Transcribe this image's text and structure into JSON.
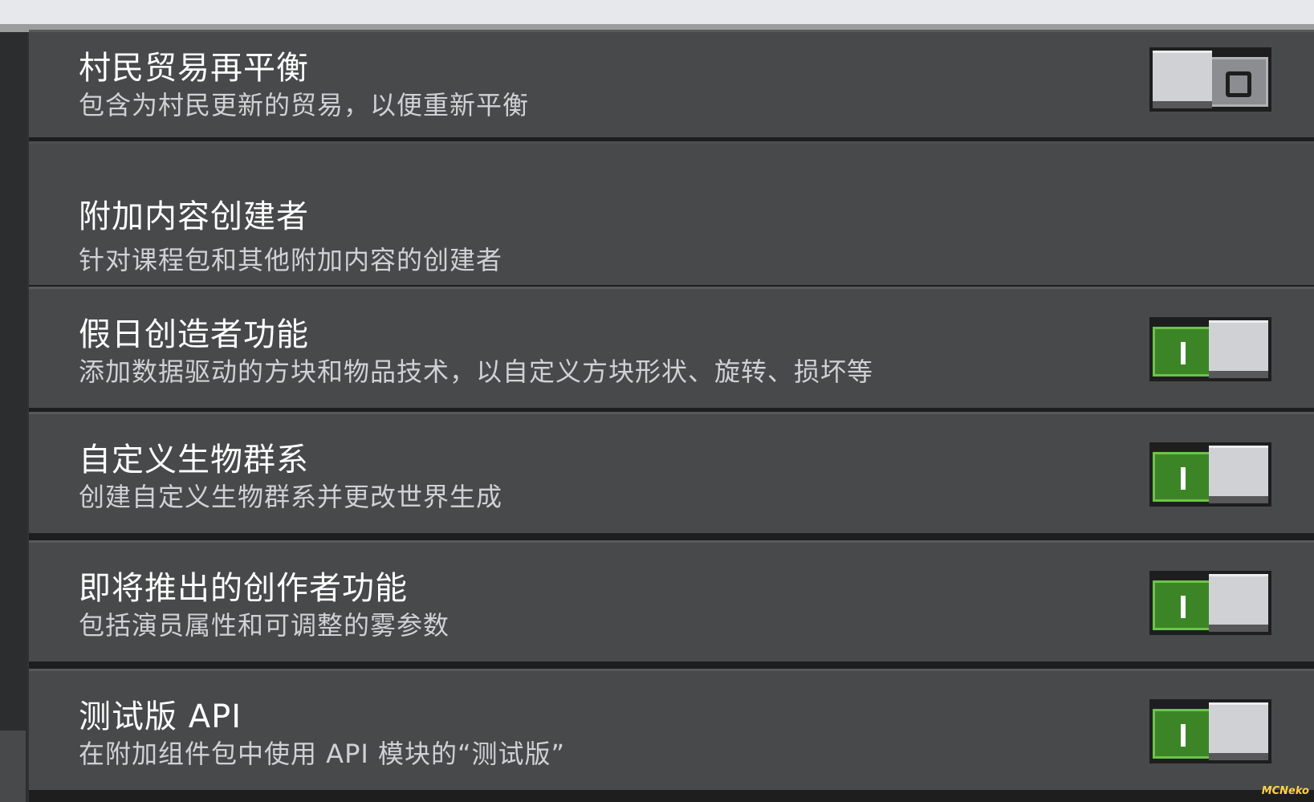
{
  "settings": [
    {
      "title": "村民贸易再平衡",
      "description": "包含为村民更新的贸易，以便重新平衡",
      "enabled": false
    },
    {
      "title": "附加内容创建者",
      "description": "针对课程包和其他附加内容的创建者"
    },
    {
      "title": "假日创造者功能",
      "description": "添加数据驱动的方块和物品技术，以自定义方块形状、旋转、损坏等",
      "enabled": true
    },
    {
      "title": "自定义生物群系",
      "description": "创建自定义生物群系并更改世界生成",
      "enabled": true
    },
    {
      "title": "即将推出的创作者功能",
      "description": "包括演员属性和可调整的雾参数",
      "enabled": true
    },
    {
      "title": "测试版 API",
      "description": "在附加组件包中使用 API 模块的“测试版”",
      "enabled": true
    }
  ],
  "watermark": "MCNeko",
  "colors": {
    "toggle_on": "#3c8527",
    "toggle_off": "#8c8d90",
    "row_background": "#48494a",
    "panel_background": "#1e1e1f"
  }
}
